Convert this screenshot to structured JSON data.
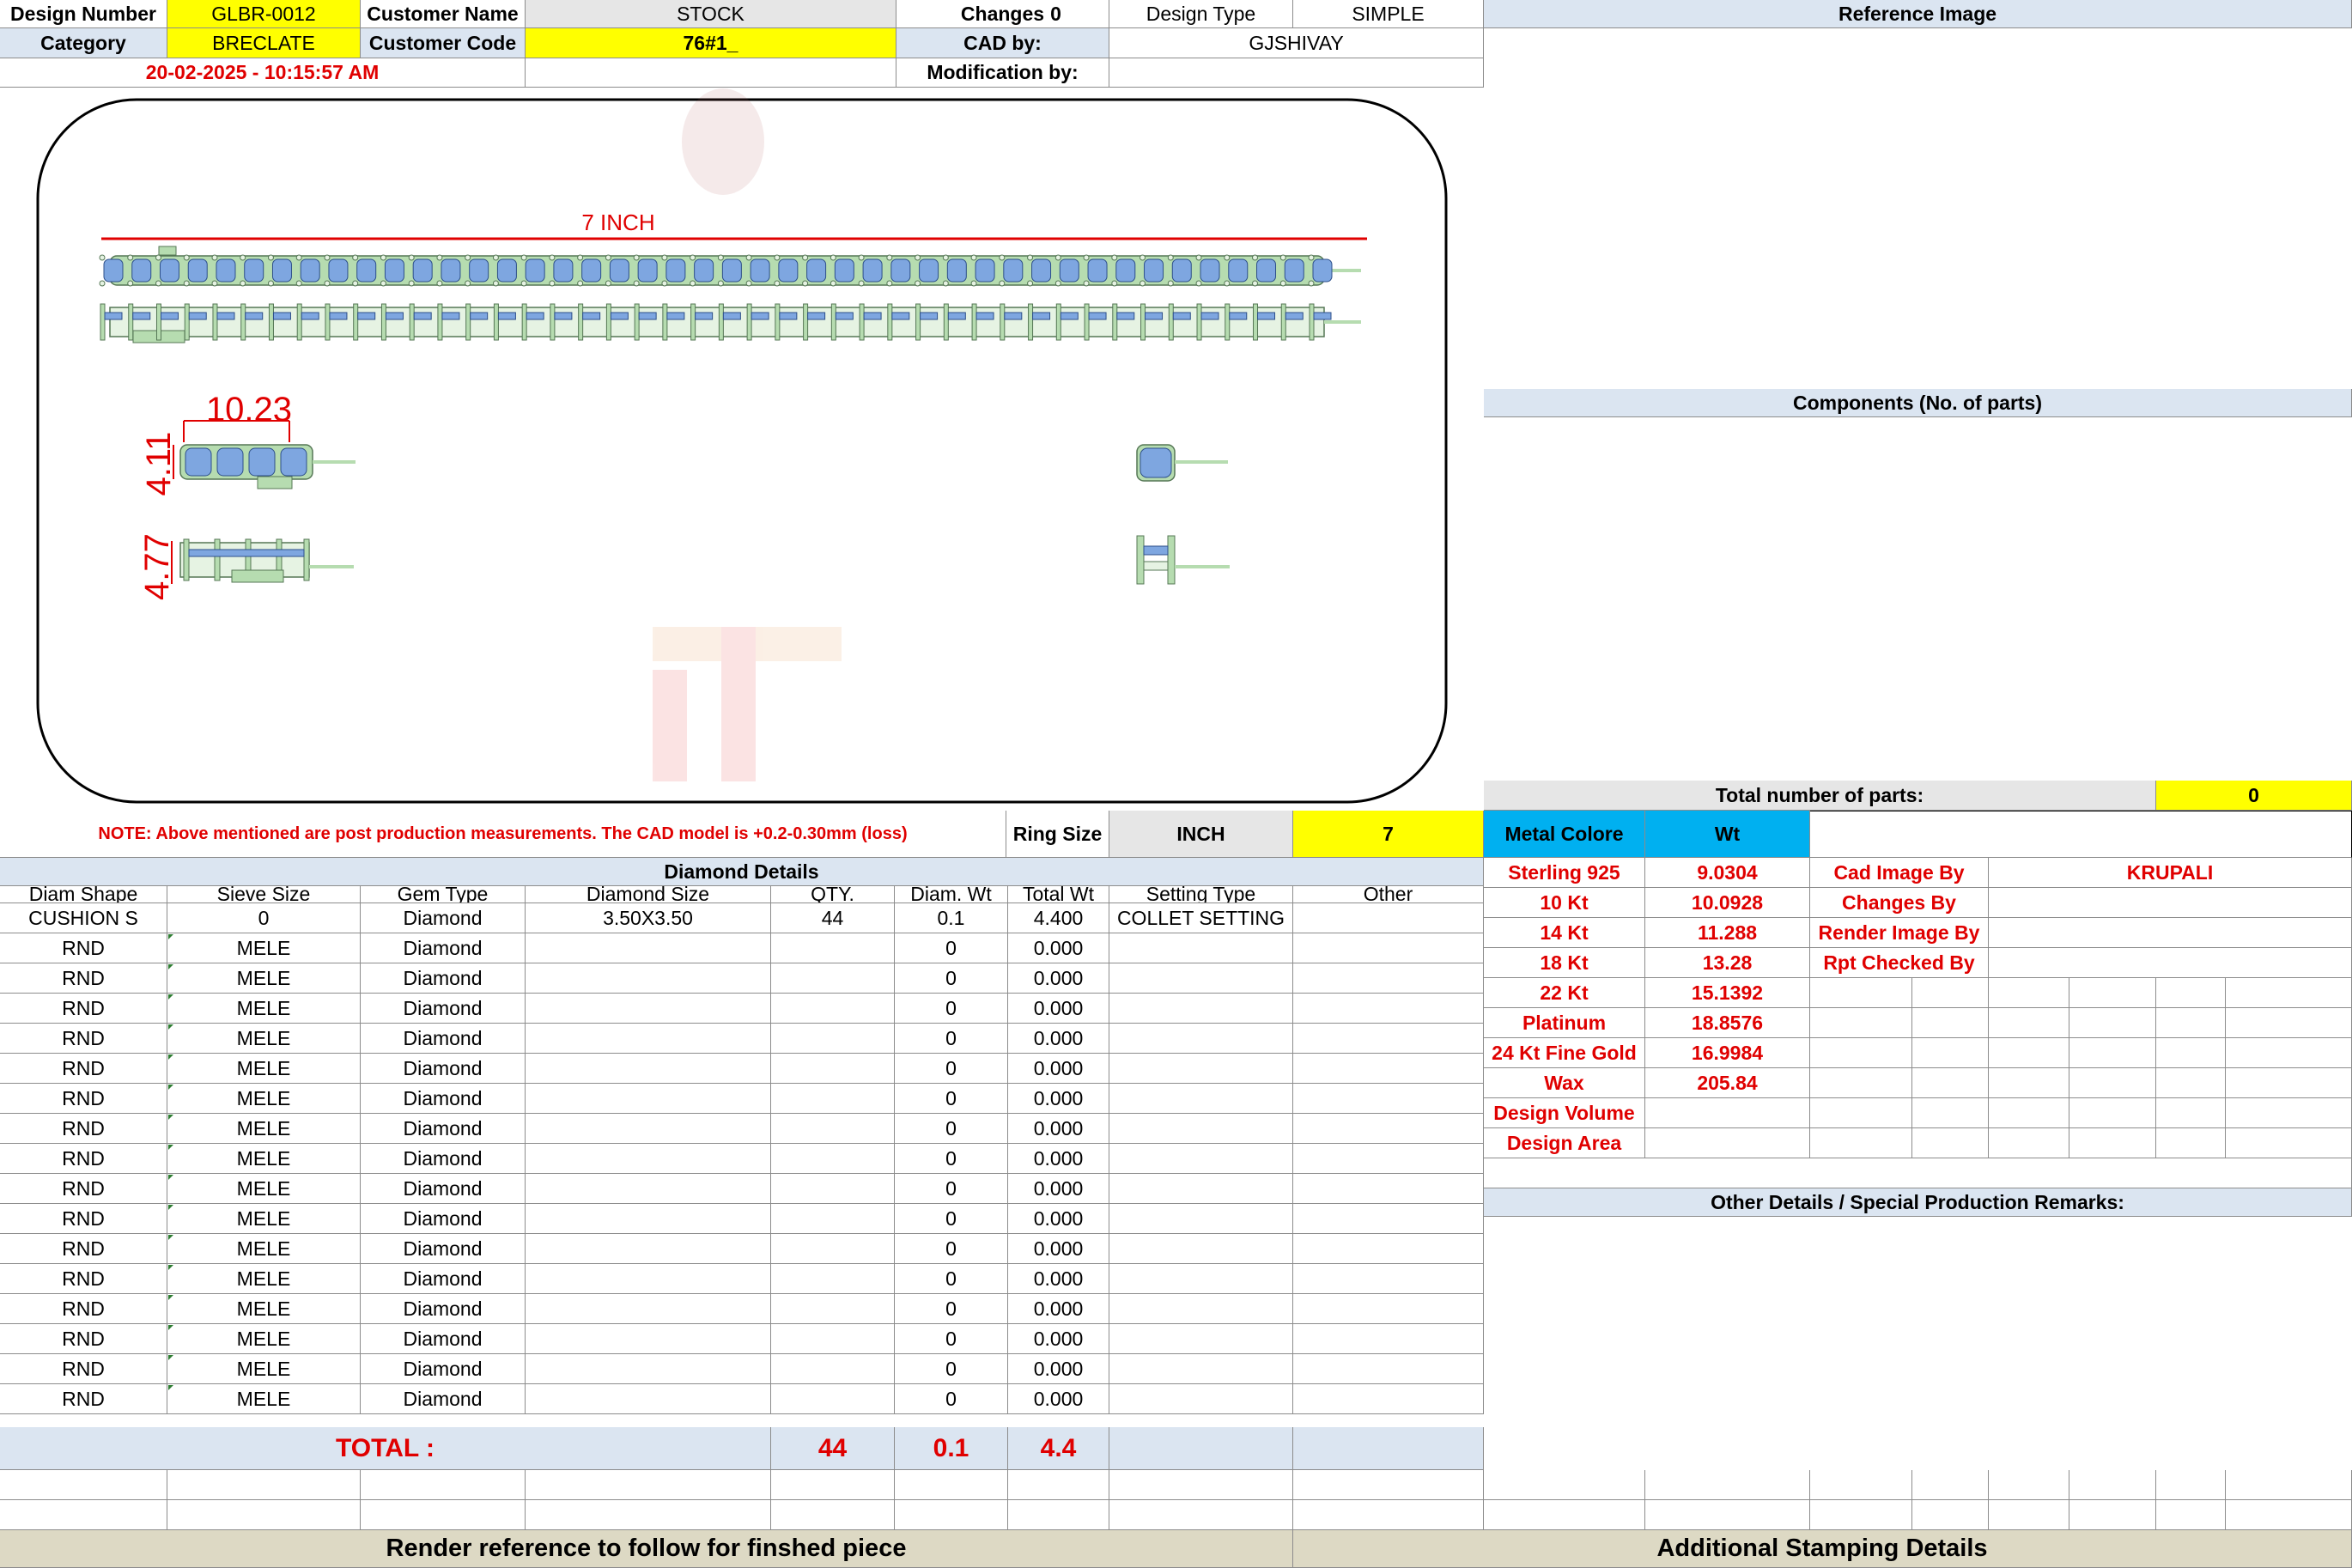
{
  "header": {
    "design_number_label": "Design Number",
    "design_number": "GLBR-0012",
    "customer_name_label": "Customer Name",
    "customer_name": "STOCK",
    "changes_label": "Changes",
    "changes_value": "0",
    "design_type_label": "Design Type",
    "design_type": "SIMPLE",
    "reference_image_label": "Reference Image",
    "category_label": "Category",
    "category": "BRECLATE",
    "customer_code_label": "Customer Code",
    "customer_code": "76#1_",
    "cad_by_label": "CAD by:",
    "cad_by": "GJSHIVAY",
    "datetime": "20-02-2025 - 10:15:57 AM",
    "modification_label": "Modification by:"
  },
  "drawing": {
    "length_label": "7 INCH",
    "width_dim": "10.23",
    "height_dim": "4.11",
    "side_height_dim": "4.77"
  },
  "components": {
    "title": "Components (No. of parts)",
    "total_label": "Total number of parts:",
    "total_value": "0"
  },
  "note": {
    "text": "NOTE: Above mentioned are post production measurements. The CAD model is +0.2-0.30mm (loss)",
    "ring_size_label": "Ring Size",
    "ring_size_unit": "INCH",
    "ring_size_value": "7"
  },
  "metal": {
    "header_label": "Metal Colore",
    "wt_label": "Wt",
    "rows": [
      {
        "name": "Sterling 925",
        "wt": "9.0304",
        "right_label": "Cad Image By",
        "right_value": "KRUPALI"
      },
      {
        "name": "10 Kt",
        "wt": "10.0928",
        "right_label": "Changes By",
        "right_value": ""
      },
      {
        "name": "14 Kt",
        "wt": "11.288",
        "right_label": "Render Image By",
        "right_value": ""
      },
      {
        "name": "18 Kt",
        "wt": "13.28",
        "right_label": "Rpt Checked By",
        "right_value": ""
      },
      {
        "name": "22 Kt",
        "wt": "15.1392"
      },
      {
        "name": "Platinum",
        "wt": "18.8576"
      },
      {
        "name": "24 Kt Fine Gold",
        "wt": "16.9984"
      },
      {
        "name": "Wax",
        "wt": "205.84"
      },
      {
        "name": "Design Volume",
        "wt": ""
      },
      {
        "name": "Design Area",
        "wt": ""
      }
    ]
  },
  "other_details": {
    "title": "Other Details / Special Production Remarks:"
  },
  "diamond": {
    "title": "Diamond Details",
    "columns": [
      "Diam Shape",
      "Sieve Size",
      "Gem Type",
      "Diamond Size",
      "QTY.",
      "Diam. Wt",
      "Total Wt",
      "Setting Type",
      "Other"
    ],
    "rows": [
      [
        "CUSHION S",
        "0",
        "Diamond",
        "3.50X3.50",
        "44",
        "0.1",
        "4.400",
        "COLLET SETTING",
        ""
      ],
      [
        "RND",
        "MELE",
        "Diamond",
        "",
        "",
        "0",
        "0.000",
        "",
        ""
      ],
      [
        "RND",
        "MELE",
        "Diamond",
        "",
        "",
        "0",
        "0.000",
        "",
        ""
      ],
      [
        "RND",
        "MELE",
        "Diamond",
        "",
        "",
        "0",
        "0.000",
        "",
        ""
      ],
      [
        "RND",
        "MELE",
        "Diamond",
        "",
        "",
        "0",
        "0.000",
        "",
        ""
      ],
      [
        "RND",
        "MELE",
        "Diamond",
        "",
        "",
        "0",
        "0.000",
        "",
        ""
      ],
      [
        "RND",
        "MELE",
        "Diamond",
        "",
        "",
        "0",
        "0.000",
        "",
        ""
      ],
      [
        "RND",
        "MELE",
        "Diamond",
        "",
        "",
        "0",
        "0.000",
        "",
        ""
      ],
      [
        "RND",
        "MELE",
        "Diamond",
        "",
        "",
        "0",
        "0.000",
        "",
        ""
      ],
      [
        "RND",
        "MELE",
        "Diamond",
        "",
        "",
        "0",
        "0.000",
        "",
        ""
      ],
      [
        "RND",
        "MELE",
        "Diamond",
        "",
        "",
        "0",
        "0.000",
        "",
        ""
      ],
      [
        "RND",
        "MELE",
        "Diamond",
        "",
        "",
        "0",
        "0.000",
        "",
        ""
      ],
      [
        "RND",
        "MELE",
        "Diamond",
        "",
        "",
        "0",
        "0.000",
        "",
        ""
      ],
      [
        "RND",
        "MELE",
        "Diamond",
        "",
        "",
        "0",
        "0.000",
        "",
        ""
      ],
      [
        "RND",
        "MELE",
        "Diamond",
        "",
        "",
        "0",
        "0.000",
        "",
        ""
      ],
      [
        "RND",
        "MELE",
        "Diamond",
        "",
        "",
        "0",
        "0.000",
        "",
        ""
      ],
      [
        "RND",
        "MELE",
        "Diamond",
        "",
        "",
        "0",
        "0.000",
        "",
        ""
      ]
    ],
    "total_label": "TOTAL :",
    "total_qty": "44",
    "total_diam_wt": "0.1",
    "total_wt": "4.4"
  },
  "footer": {
    "render_ref": "Render reference to follow for finshed piece",
    "stamping": "Additional Stamping Details"
  },
  "colors": {
    "yellow": "#ffff00",
    "light_blue": "#dbe5f1",
    "sky_blue": "#00b0f0",
    "red": "#e00000",
    "tan": "#ddd9c4",
    "metal_green": "#b6dcb0",
    "stone_blue": "#7ea6e0"
  }
}
